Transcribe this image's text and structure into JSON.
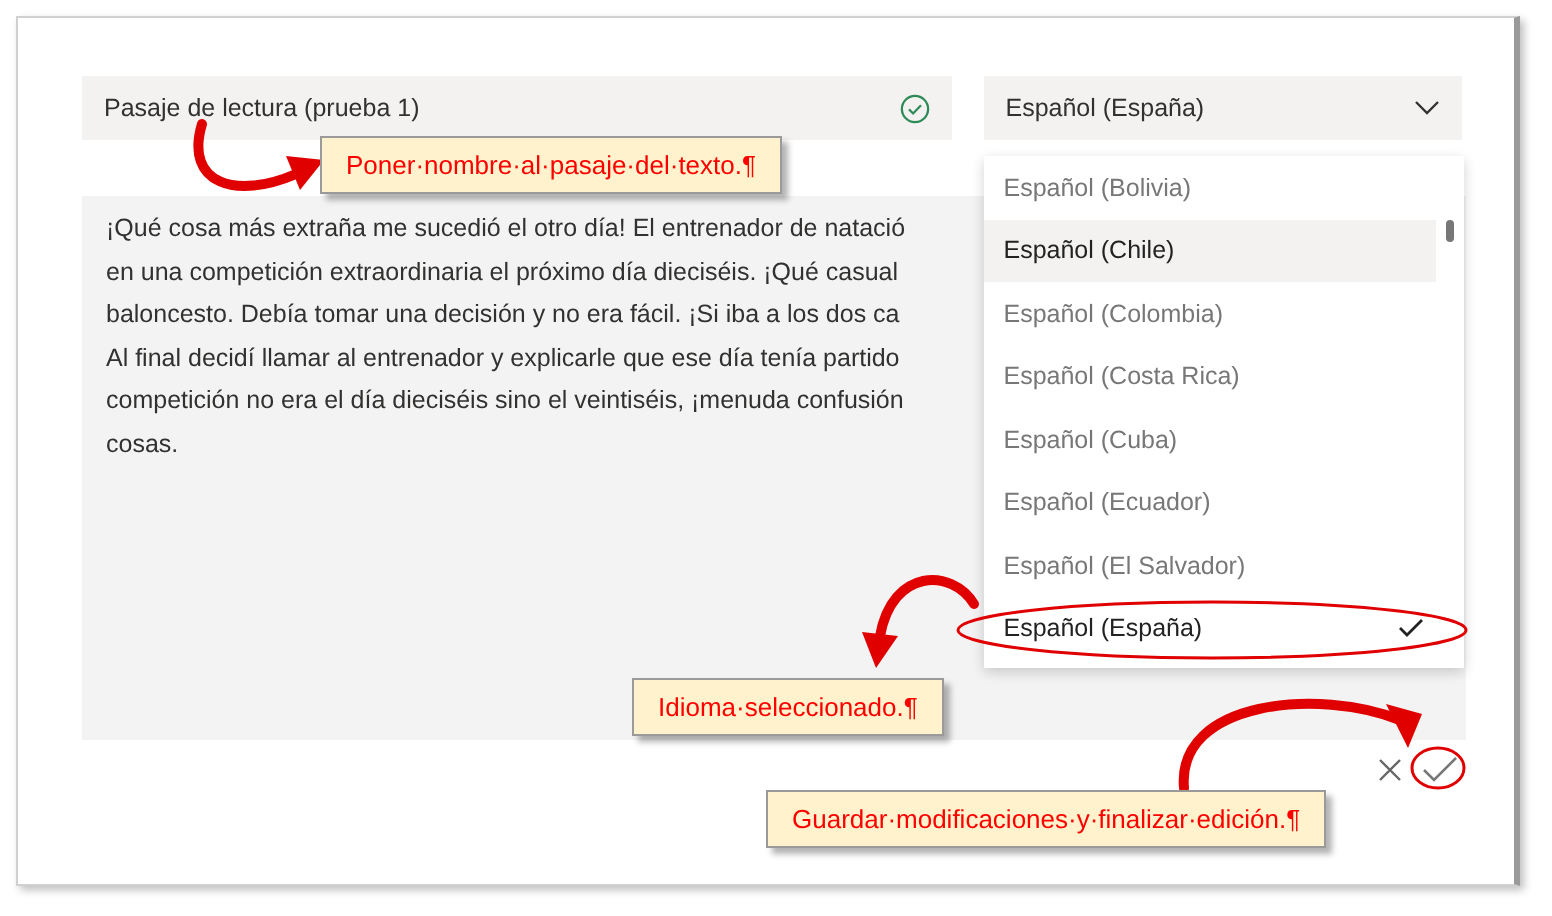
{
  "title_field": {
    "value": "Pasaje de lectura (prueba 1)",
    "valid": true
  },
  "language_select": {
    "value": "Español (España)",
    "expanded": true
  },
  "language_options": [
    {
      "label": "Español (Bolivia)",
      "hovered": false,
      "selected": false
    },
    {
      "label": "Español (Chile)",
      "hovered": true,
      "selected": false
    },
    {
      "label": "Español (Colombia)",
      "hovered": false,
      "selected": false
    },
    {
      "label": "Español (Costa Rica)",
      "hovered": false,
      "selected": false
    },
    {
      "label": "Español (Cuba)",
      "hovered": false,
      "selected": false
    },
    {
      "label": "Español (Ecuador)",
      "hovered": false,
      "selected": false
    },
    {
      "label": "Español (El Salvador)",
      "hovered": false,
      "selected": false
    },
    {
      "label": "Español (España)",
      "hovered": false,
      "selected": true
    }
  ],
  "passage_lines": [
    "¡Qué cosa más extraña me sucedió el otro día! El entrenador de natació",
    "en una competición extraordinaria el próximo día dieciséis. ¡Qué casual",
    "baloncesto. Debía tomar una decisión y no era fácil. ¡Si iba a los dos ca",
    "Al final decidí llamar al entrenador y explicarle que ese día tenía partido",
    "competición no era el día dieciséis sino el veintiséis, ¡menuda confusión",
    "cosas."
  ],
  "annotations": [
    {
      "text": "Poner·nombre·al·pasaje·del·texto.¶"
    },
    {
      "text": "Idioma·seleccionado.¶"
    },
    {
      "text": "Guardar·modificaciones·y·finalizar·edición.¶"
    }
  ]
}
